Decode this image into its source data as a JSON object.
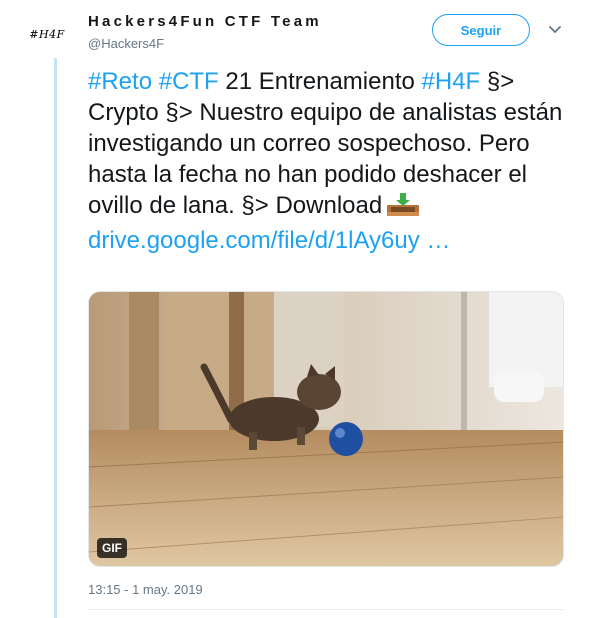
{
  "author": {
    "avatar_text": "#H4F",
    "display_name": "Hackers4Fun CTF Team",
    "handle": "@Hackers4F"
  },
  "follow_button": {
    "label": "Seguir"
  },
  "tweet": {
    "text_parts": {
      "hashtag_reto": "#Reto",
      "hashtag_ctf": "#CTF",
      "text_1": " 21 Entrenamiento ",
      "hashtag_h4f": "#H4F",
      "text_2": "  §> Crypto §> Nuestro equipo de analistas están investigando un correo sospechoso. Pero hasta la fecha no han podido deshacer el ovillo de lana. §> Download",
      "link": "drive.google.com/file/d/1lAy6uy  …"
    },
    "media_badge": "GIF",
    "timestamp": "13:15 - 1 may. 2019"
  },
  "icons": {
    "caret": "chevron-down-icon",
    "download": "inbox-tray-icon"
  },
  "colors": {
    "accent": "#1da1f2",
    "text": "#14171a",
    "muted": "#657786",
    "thread_line": "#c5e3f6"
  }
}
